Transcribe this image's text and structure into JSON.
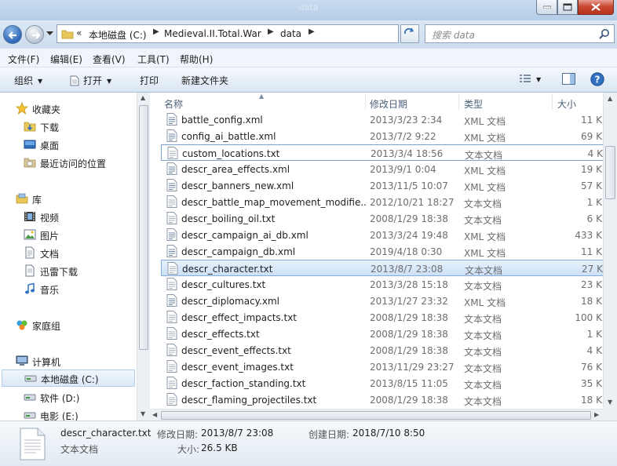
{
  "window": {
    "title": "data"
  },
  "address": {
    "overflow": "«",
    "crumbs": [
      "本地磁盘 (C:)",
      "Medieval.II.Total.War",
      "data"
    ]
  },
  "search": {
    "placeholder": "搜索 data"
  },
  "menu": [
    "文件(F)",
    "编辑(E)",
    "查看(V)",
    "工具(T)",
    "帮助(H)"
  ],
  "toolbar": {
    "organize": "组织",
    "open": "打开",
    "print": "打印",
    "new_folder": "新建文件夹"
  },
  "nav": {
    "favorites": "收藏夹",
    "downloads": "下载",
    "desktop": "桌面",
    "recent": "最近访问的位置",
    "libraries": "库",
    "videos": "视频",
    "pictures": "图片",
    "documents": "文档",
    "thunder": "迅雷下载",
    "music": "音乐",
    "homegroup": "家庭组",
    "computer": "计算机",
    "drive_c": "本地磁盘 (C:)",
    "drive_d": "软件 (D:)",
    "drive_e": "电影 (E:)"
  },
  "columns": {
    "name": "名称",
    "date": "修改日期",
    "type": "类型",
    "size": "大小"
  },
  "files": [
    {
      "name": "battle_config.xml",
      "date": "2013/3/23 2:34",
      "type": "XML 文档",
      "size": "11 K"
    },
    {
      "name": "config_ai_battle.xml",
      "date": "2013/7/2 9:22",
      "type": "XML 文档",
      "size": "69 K"
    },
    {
      "name": "custom_locations.txt",
      "date": "2013/3/4 18:56",
      "type": "文本文档",
      "size": "4 K"
    },
    {
      "name": "descr_area_effects.xml",
      "date": "2013/9/1 0:04",
      "type": "XML 文档",
      "size": "19 K"
    },
    {
      "name": "descr_banners_new.xml",
      "date": "2013/11/5 10:07",
      "type": "XML 文档",
      "size": "57 K"
    },
    {
      "name": "descr_battle_map_movement_modifie...",
      "date": "2012/10/21 18:27",
      "type": "文本文档",
      "size": "1 K"
    },
    {
      "name": "descr_boiling_oil.txt",
      "date": "2008/1/29 18:38",
      "type": "文本文档",
      "size": "6 K"
    },
    {
      "name": "descr_campaign_ai_db.xml",
      "date": "2013/3/24 19:48",
      "type": "XML 文档",
      "size": "433 K"
    },
    {
      "name": "descr_campaign_db.xml",
      "date": "2019/4/18 0:30",
      "type": "XML 文档",
      "size": "11 K"
    },
    {
      "name": "descr_character.txt",
      "date": "2013/8/7 23:08",
      "type": "文本文档",
      "size": "27 K"
    },
    {
      "name": "descr_cultures.txt",
      "date": "2013/3/28 15:18",
      "type": "文本文档",
      "size": "23 K"
    },
    {
      "name": "descr_diplomacy.xml",
      "date": "2013/1/27 23:32",
      "type": "XML 文档",
      "size": "18 K"
    },
    {
      "name": "descr_effect_impacts.txt",
      "date": "2008/1/29 18:38",
      "type": "文本文档",
      "size": "100 K"
    },
    {
      "name": "descr_effects.txt",
      "date": "2008/1/29 18:38",
      "type": "文本文档",
      "size": "1 K"
    },
    {
      "name": "descr_event_effects.txt",
      "date": "2008/1/29 18:38",
      "type": "文本文档",
      "size": "4 K"
    },
    {
      "name": "descr_event_images.txt",
      "date": "2013/11/29 23:27",
      "type": "文本文档",
      "size": "76 K"
    },
    {
      "name": "descr_faction_standing.txt",
      "date": "2013/8/15 11:05",
      "type": "文本文档",
      "size": "35 K"
    },
    {
      "name": "descr_flaming_projectiles.txt",
      "date": "2008/1/29 18:38",
      "type": "文本文档",
      "size": "18 K"
    }
  ],
  "details": {
    "filename": "descr_character.txt",
    "filetype": "文本文档",
    "modified_label": "修改日期:",
    "modified_value": "2013/8/7 23:08",
    "created_label": "创建日期:",
    "created_value": "2018/7/10 8:50",
    "size_label": "大小:",
    "size_value": "26.5 KB"
  }
}
